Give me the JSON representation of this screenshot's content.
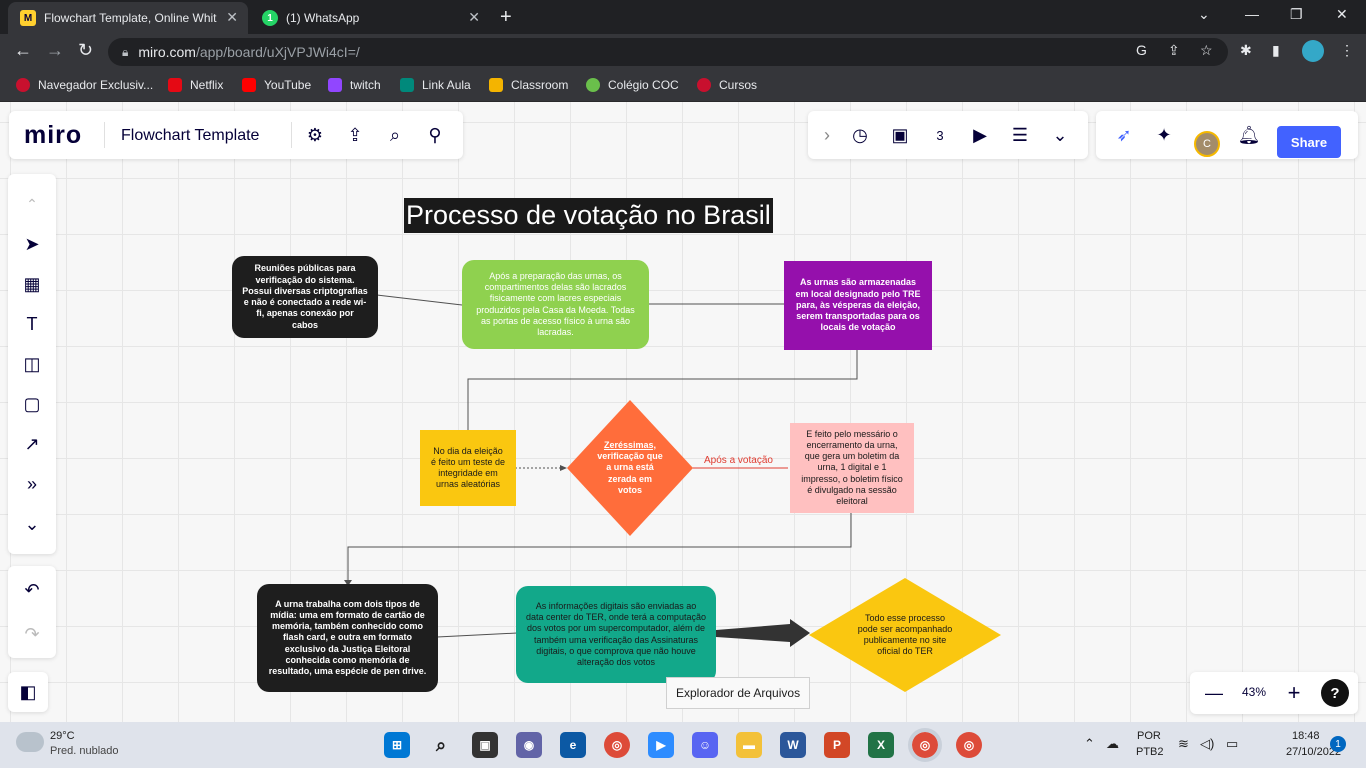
{
  "browser": {
    "tabs": [
      {
        "title": "Flowchart Template, Online Whit",
        "active": true
      },
      {
        "title": "(1) WhatsApp",
        "active": false
      }
    ],
    "url_host": "miro.com",
    "url_path": "/app/board/uXjVPJWi4cI=/",
    "bookmarks": [
      "Navegador Exclusiv...",
      "Netflix",
      "YouTube",
      "twitch",
      "Link Aula",
      "Classroom",
      "Colégio COC",
      "Cursos"
    ]
  },
  "miro": {
    "logo": "miro",
    "board_title": "Flowchart Template",
    "share_label": "Share",
    "avatar_initial": "C",
    "zoom": "43%",
    "help": "?"
  },
  "board": {
    "heading": "Processo de votação no Brasil",
    "node1": "Reuniões públicas para verificação do sistema. Possui diversas criptografias e não é conectado a rede wi-fi, apenas conexão por cabos",
    "node2": "Após a preparação das urnas, os compartimentos delas são lacrados fisicamente com lacres especiais produzidos pela Casa da Moeda. Todas as portas de acesso físico à urna são lacradas.",
    "node3": "As urnas são armazenadas em local designado pelo TRE para, às vésperas da eleição, serem transportadas para os locais de votação",
    "node4": "No dia da eleição é feito um teste de integridade em urnas aleatórias",
    "node5_title": "Zeréssimas,",
    "node5_rest": "verificação que a urna está zerada em votos",
    "connector_label": "Após a votação",
    "node6": "E feito pelo messário o encerramento da urna, que gera um boletim da urna, 1 digital e 1 impresso, o boletim físico é divulgado na sessão eleitoral",
    "node7": "A urna trabalha com dois tipos de mídia: uma em formato de cartão de memória, também conhecido como flash card, e outra em formato exclusivo da Justiça Eleitoral conhecida como memória de resultado, uma espécie de pen drive.",
    "node8": "As informações digitais são enviadas ao data center do TER, onde terá a computação dos votos por um supercomputador, além de também uma verificação das Assinaturas digitais, o que comprova que não houve alteração dos votos",
    "node9": "Todo esse processo pode ser acompanhado publicamente no site oficial do TER"
  },
  "tooltip": "Explorador de Arquivos",
  "taskbar": {
    "weather_temp": "29°C",
    "weather_desc": "Pred. nublado",
    "lang1": "POR",
    "lang2": "PTB2",
    "time": "18:48",
    "date": "27/10/2022",
    "notif": "1"
  },
  "colors": {
    "black_node": "#1e1e1e",
    "green_node": "#8fd14f",
    "purple_node": "#9510ac",
    "yellow_node": "#fac710",
    "orange_diamond": "#ff6d3b",
    "pink_node": "#ffc0c0",
    "teal_node": "#12a88a",
    "yellow_diamond": "#fac710",
    "accent": "#4262ff"
  }
}
